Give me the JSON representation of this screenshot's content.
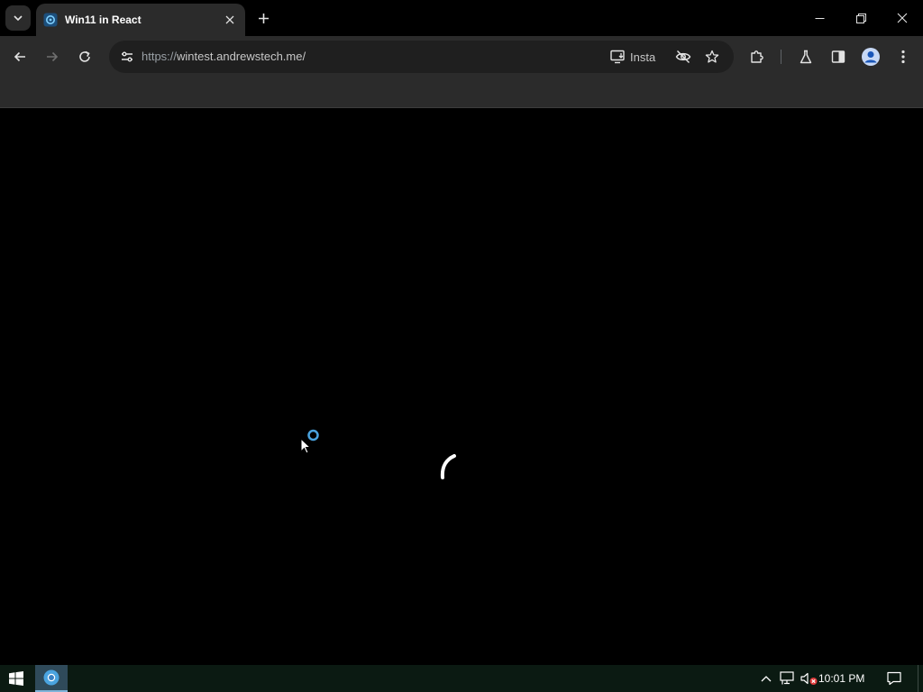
{
  "browser": {
    "tab": {
      "title": "Win11 in React",
      "favicon": "win11-react-favicon"
    },
    "address_bar": {
      "scheme": "https://",
      "host_path": "wintest.andrewstech.me/"
    },
    "install_label": "Insta"
  },
  "taskbar": {
    "clock": "10:01 PM",
    "pinned": [
      "start-icon",
      "chrome-icon"
    ],
    "tray": [
      "chevron-up-icon",
      "network-icon",
      "volume-muted-icon",
      "notification-icon"
    ]
  },
  "page": {
    "state": "loading",
    "spinner": "loading-spinner"
  },
  "colors": {
    "tab_bg": "#2b2b2b",
    "toolbar_bg": "#2b2b2b",
    "omnibox_bg": "#1f1f1f",
    "page_bg": "#000000",
    "taskbar_bg": "#0b1a12",
    "accent": "#4aa3df"
  }
}
